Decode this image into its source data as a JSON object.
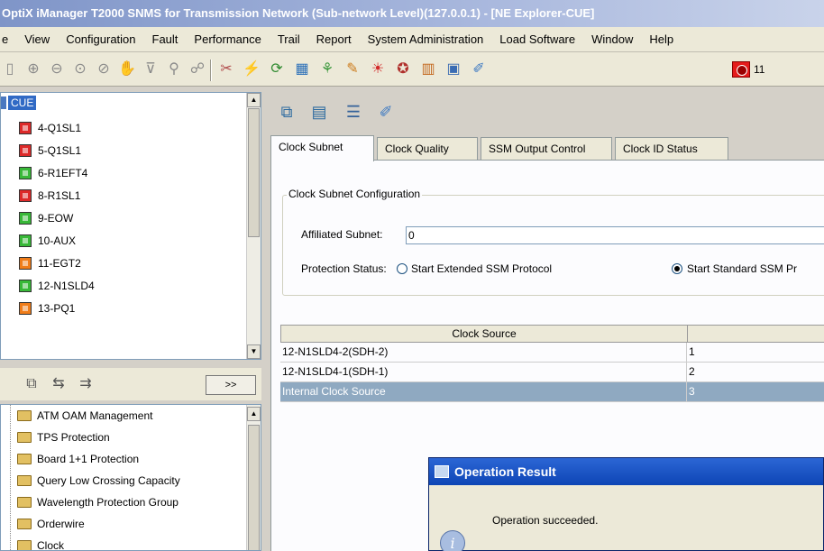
{
  "window": {
    "title": "OptiX iManager T2000 SNMS for Transmission Network (Sub-network Level)(127.0.0.1) - [NE Explorer-CUE]"
  },
  "menu": [
    "e",
    "View",
    "Configuration",
    "Fault",
    "Performance",
    "Trail",
    "Report",
    "System Administration",
    "Load Software",
    "Window",
    "Help"
  ],
  "toolbar": {
    "alarm_count": "11"
  },
  "ne_tree": {
    "root": "CUE",
    "boards": [
      {
        "label": "4-Q1SL1",
        "color": "#dd2a2a"
      },
      {
        "label": "5-Q1SL1",
        "color": "#dd2a2a"
      },
      {
        "label": "6-R1EFT4",
        "color": "#38b838"
      },
      {
        "label": "8-R1SL1",
        "color": "#dd2a2a"
      },
      {
        "label": "9-EOW",
        "color": "#38b838"
      },
      {
        "label": "10-AUX",
        "color": "#38b838"
      },
      {
        "label": "11-EGT2",
        "color": "#f07d1a"
      },
      {
        "label": "12-N1SLD4",
        "color": "#38b838"
      },
      {
        "label": "13-PQ1",
        "color": "#f07d1a"
      }
    ]
  },
  "nav": {
    "more_label": ">>"
  },
  "function_tree": [
    "ATM OAM Management",
    "TPS Protection",
    "Board 1+1 Protection",
    "Query Low Crossing Capacity",
    "Wavelength Protection Group",
    "Orderwire",
    "Clock"
  ],
  "tabs": [
    "Clock Subnet",
    "Clock Quality",
    "SSM Output Control",
    "Clock ID Status"
  ],
  "clock_subnet": {
    "group_title": "Clock Subnet Configuration",
    "affiliated_label": "Affiliated Subnet:",
    "affiliated_value": "0",
    "protection_label": "Protection Status:",
    "option_extended": "Start Extended SSM Protocol",
    "option_standard": "Start Standard SSM Pr"
  },
  "table": {
    "headers": [
      "Clock Source",
      ""
    ],
    "rows": [
      {
        "source": "12-N1SLD4-2(SDH-2)",
        "priority": "1"
      },
      {
        "source": "12-N1SLD4-1(SDH-1)",
        "priority": "2"
      },
      {
        "source": "Internal Clock Source",
        "priority": "3"
      }
    ]
  },
  "dialog": {
    "title": "Operation Result",
    "message": "Operation succeeded."
  }
}
